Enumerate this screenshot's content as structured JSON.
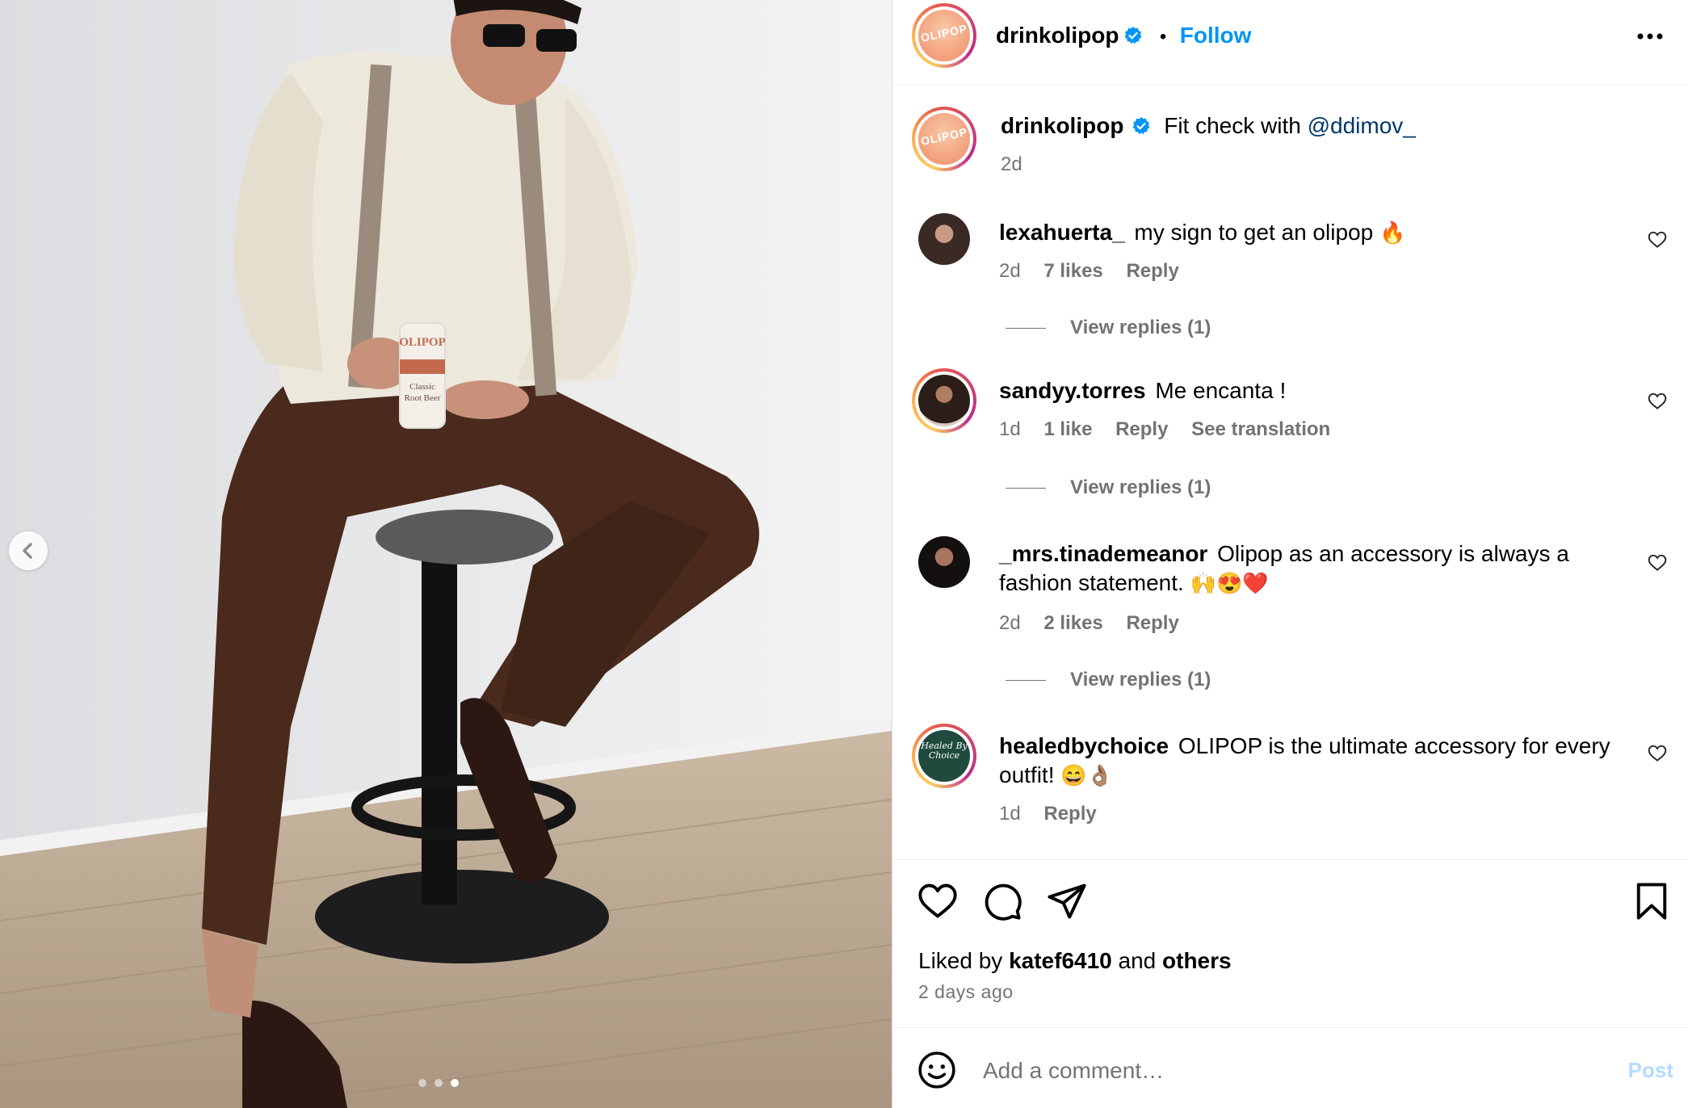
{
  "post": {
    "carousel": {
      "total": 3,
      "current_index": 3,
      "prev_icon": "chevron-left-icon"
    },
    "can_text": [
      "OLIPOP",
      "Classic",
      "Root Beer"
    ]
  },
  "header": {
    "username": "drinkolipop",
    "avatar_text": "OLIPOP",
    "separator": "•",
    "follow_label": "Follow",
    "more_icon": "more-horizontal-icon",
    "verified_color": "#0095f6"
  },
  "caption": {
    "username": "drinkolipop",
    "text": "Fit check with",
    "mention": "@ddimov_",
    "time": "2d"
  },
  "comments": [
    {
      "username": "lexahuerta_",
      "text": "my sign to get an olipop",
      "emoji": "🔥",
      "time": "2d",
      "likes": "7 likes",
      "reply": "Reply",
      "view_replies": "View replies (1)"
    },
    {
      "username": "sandyy.torres",
      "text": "Me encanta !",
      "emoji": "",
      "time": "1d",
      "likes": "1 like",
      "reply": "Reply",
      "translation": "See translation",
      "view_replies": "View replies (1)"
    },
    {
      "username": "_mrs.tinademeanor",
      "text": "Olipop as an accessory is always a fashion statement.",
      "emoji": "🙌😍❤️",
      "time": "2d",
      "likes": "2 likes",
      "reply": "Reply",
      "view_replies": "View replies (1)"
    },
    {
      "username": "healedbychoice",
      "text": "OLIPOP is the ultimate accessory for every outfit!",
      "emoji": "😄👌🏽",
      "avatar_text": "Healed By Choice",
      "time": "1d",
      "reply": "Reply"
    }
  ],
  "actions": {
    "like_icon": "heart-icon",
    "comment_icon": "comment-icon",
    "share_icon": "send-icon",
    "save_icon": "bookmark-icon"
  },
  "likes": {
    "prefix": "Liked by",
    "user": "katef6410",
    "and": "and",
    "others": "others",
    "time": "2 days ago"
  },
  "comment_box": {
    "emoji_icon": "smiley-icon",
    "placeholder": "Add a comment…",
    "post_label": "Post"
  },
  "colors": {
    "accent": "#0095f6",
    "muted": "#737373",
    "post_disabled": "#b3dbff"
  }
}
